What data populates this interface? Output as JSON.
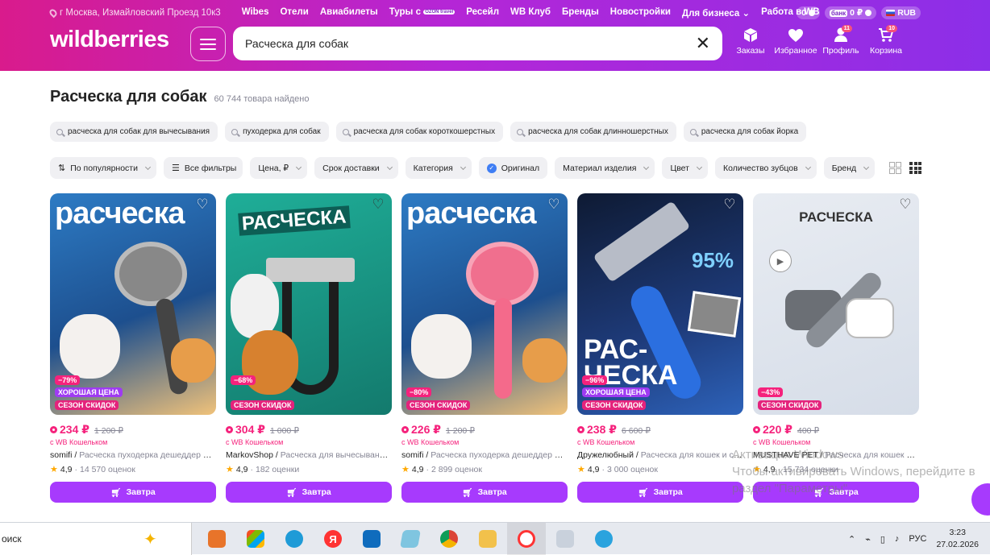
{
  "header": {
    "location": "г Москва, Измайловский Проезд 10к3",
    "nav": [
      "Wibes",
      "Отели",
      "Авиабилеты",
      "Туры с",
      "Ресейл",
      "WB Клуб",
      "Бренды",
      "Новостройки",
      "Для бизнеса",
      "Работа в WB"
    ],
    "tours_brand": "OZON travel",
    "wallet_balance": "0",
    "bank_chip": "банк",
    "bank_balance": "0 ₽",
    "currency": "RUB",
    "logo": "wildberries",
    "search_value": "Расческа для собак",
    "icons": [
      {
        "name": "orders",
        "label": "Заказы",
        "badge": ""
      },
      {
        "name": "favorites",
        "label": "Избранное",
        "badge": ""
      },
      {
        "name": "profile",
        "label": "Профиль",
        "badge": "11"
      },
      {
        "name": "cart",
        "label": "Корзина",
        "badge": "10"
      }
    ]
  },
  "page": {
    "title": "Расческа для собак",
    "found": "60 744 товара найдено"
  },
  "suggestions": [
    "расческа для собак для вычесывания",
    "пуходерка для собак",
    "расческа для собак короткошерстных",
    "расческа для собак длинношерстных",
    "расческа для собак йорка"
  ],
  "filters": [
    {
      "label": "По популярности",
      "icon": "sort-icon",
      "chevron": true
    },
    {
      "label": "Все фильтры",
      "icon": "filters-icon",
      "chevron": false
    },
    {
      "label": "Цена, ₽",
      "icon": "",
      "chevron": true
    },
    {
      "label": "Срок доставки",
      "icon": "",
      "chevron": true
    },
    {
      "label": "Категория",
      "icon": "",
      "chevron": true
    },
    {
      "label": "Оригинал",
      "icon": "check-icon",
      "chevron": false
    },
    {
      "label": "Материал изделия",
      "icon": "",
      "chevron": true
    },
    {
      "label": "Цвет",
      "icon": "",
      "chevron": true
    },
    {
      "label": "Количество зубцов",
      "icon": "",
      "chevron": true
    },
    {
      "label": "Бренд",
      "icon": "",
      "chevron": true
    }
  ],
  "products": [
    {
      "img_title": "расческа",
      "bg": "#2b6fb8",
      "discount": "−79%",
      "good_price": "ХОРОШАЯ ЦЕНА",
      "season": "СЕЗОН СКИДОК",
      "price": "234 ₽",
      "old": "1 200 ₽",
      "wallet": "с WB Кошельком",
      "brand": "somifi",
      "desc": "Расческа пуходерка дешеддер для кошек и собак",
      "rating": "4,9",
      "reviews": "14 570 оценок",
      "buy": "Завтра"
    },
    {
      "img_title": "РАСЧЕСКА",
      "bg": "#1a9a8a",
      "discount": "−68%",
      "good_price": "",
      "season": "СЕЗОН СКИДОК",
      "price": "304 ₽",
      "old": "1 000 ₽",
      "wallet": "с WB Кошельком",
      "brand": "MarkovShop",
      "desc": "Расческа для вычесывания собак и кошек",
      "rating": "4,9",
      "reviews": "182 оценки",
      "buy": "Завтра"
    },
    {
      "img_title": "расческа",
      "bg": "#2b6fb8",
      "discount": "−80%",
      "good_price": "",
      "season": "СЕЗОН СКИДОК",
      "price": "226 ₽",
      "old": "1 200 ₽",
      "wallet": "с WB Кошельком",
      "brand": "somifi",
      "desc": "Расческа пуходерка дешеддер для кошек и собак",
      "rating": "4,9",
      "reviews": "2 899 оценок",
      "buy": "Завтра"
    },
    {
      "img_title": "РАС-ЧЕСКА",
      "bg": "#1f3f86",
      "discount": "−96%",
      "good_price": "ХОРОШАЯ ЦЕНА",
      "season": "СЕЗОН СКИДОК",
      "price": "238 ₽",
      "old": "6 600 ₽",
      "wallet": "с WB Кошельком",
      "brand": "Дружелюбный",
      "desc": "Расческа для кошек и собак",
      "rating": "4,9",
      "reviews": "3 000 оценок",
      "buy": "Завтра"
    },
    {
      "img_title": "РАСЧЕСКА",
      "bg": "#dfe5ee",
      "discount": "−43%",
      "good_price": "",
      "season": "СЕЗОН СКИДОК",
      "price": "220 ₽",
      "old": "400 ₽",
      "wallet": "с WB Кошельком",
      "brand": "MUSTHAVE PET",
      "desc": "Расческа для кошек с кнопкой",
      "rating": "4,9",
      "reviews": "15 734 оценки",
      "buy": "Завтра"
    }
  ],
  "watermark": {
    "line1": "Активация Windows",
    "line2": "Чтобы активировать Windows, перейдите в",
    "line3": "раздел \"Параметры\"."
  },
  "taskbar": {
    "search": "оиск",
    "lang": "РУС",
    "time": "3:23",
    "date": "27.02.2026"
  }
}
